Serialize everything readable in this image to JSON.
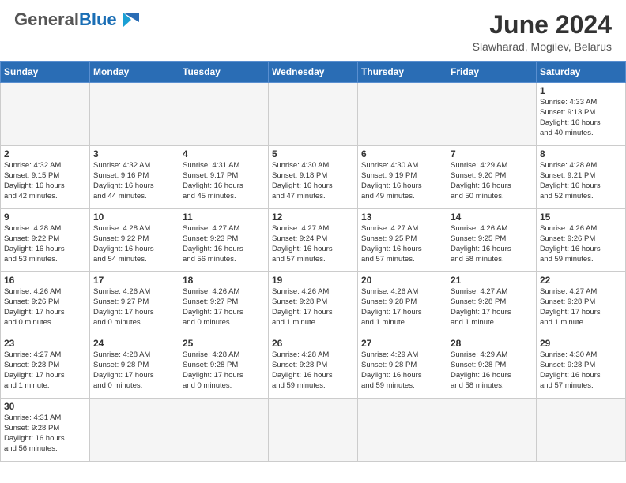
{
  "header": {
    "logo_general": "General",
    "logo_blue": "Blue",
    "month_title": "June 2024",
    "location": "Slawharad, Mogilev, Belarus"
  },
  "weekdays": [
    "Sunday",
    "Monday",
    "Tuesday",
    "Wednesday",
    "Thursday",
    "Friday",
    "Saturday"
  ],
  "weeks": [
    [
      {
        "day": "",
        "info": ""
      },
      {
        "day": "",
        "info": ""
      },
      {
        "day": "",
        "info": ""
      },
      {
        "day": "",
        "info": ""
      },
      {
        "day": "",
        "info": ""
      },
      {
        "day": "",
        "info": ""
      },
      {
        "day": "1",
        "info": "Sunrise: 4:33 AM\nSunset: 9:13 PM\nDaylight: 16 hours\nand 40 minutes."
      }
    ],
    [
      {
        "day": "2",
        "info": "Sunrise: 4:32 AM\nSunset: 9:15 PM\nDaylight: 16 hours\nand 42 minutes."
      },
      {
        "day": "3",
        "info": "Sunrise: 4:32 AM\nSunset: 9:16 PM\nDaylight: 16 hours\nand 44 minutes."
      },
      {
        "day": "4",
        "info": "Sunrise: 4:31 AM\nSunset: 9:17 PM\nDaylight: 16 hours\nand 45 minutes."
      },
      {
        "day": "5",
        "info": "Sunrise: 4:30 AM\nSunset: 9:18 PM\nDaylight: 16 hours\nand 47 minutes."
      },
      {
        "day": "6",
        "info": "Sunrise: 4:30 AM\nSunset: 9:19 PM\nDaylight: 16 hours\nand 49 minutes."
      },
      {
        "day": "7",
        "info": "Sunrise: 4:29 AM\nSunset: 9:20 PM\nDaylight: 16 hours\nand 50 minutes."
      },
      {
        "day": "8",
        "info": "Sunrise: 4:28 AM\nSunset: 9:21 PM\nDaylight: 16 hours\nand 52 minutes."
      }
    ],
    [
      {
        "day": "9",
        "info": "Sunrise: 4:28 AM\nSunset: 9:22 PM\nDaylight: 16 hours\nand 53 minutes."
      },
      {
        "day": "10",
        "info": "Sunrise: 4:28 AM\nSunset: 9:22 PM\nDaylight: 16 hours\nand 54 minutes."
      },
      {
        "day": "11",
        "info": "Sunrise: 4:27 AM\nSunset: 9:23 PM\nDaylight: 16 hours\nand 56 minutes."
      },
      {
        "day": "12",
        "info": "Sunrise: 4:27 AM\nSunset: 9:24 PM\nDaylight: 16 hours\nand 57 minutes."
      },
      {
        "day": "13",
        "info": "Sunrise: 4:27 AM\nSunset: 9:25 PM\nDaylight: 16 hours\nand 57 minutes."
      },
      {
        "day": "14",
        "info": "Sunrise: 4:26 AM\nSunset: 9:25 PM\nDaylight: 16 hours\nand 58 minutes."
      },
      {
        "day": "15",
        "info": "Sunrise: 4:26 AM\nSunset: 9:26 PM\nDaylight: 16 hours\nand 59 minutes."
      }
    ],
    [
      {
        "day": "16",
        "info": "Sunrise: 4:26 AM\nSunset: 9:26 PM\nDaylight: 17 hours\nand 0 minutes."
      },
      {
        "day": "17",
        "info": "Sunrise: 4:26 AM\nSunset: 9:27 PM\nDaylight: 17 hours\nand 0 minutes."
      },
      {
        "day": "18",
        "info": "Sunrise: 4:26 AM\nSunset: 9:27 PM\nDaylight: 17 hours\nand 0 minutes."
      },
      {
        "day": "19",
        "info": "Sunrise: 4:26 AM\nSunset: 9:28 PM\nDaylight: 17 hours\nand 1 minute."
      },
      {
        "day": "20",
        "info": "Sunrise: 4:26 AM\nSunset: 9:28 PM\nDaylight: 17 hours\nand 1 minute."
      },
      {
        "day": "21",
        "info": "Sunrise: 4:27 AM\nSunset: 9:28 PM\nDaylight: 17 hours\nand 1 minute."
      },
      {
        "day": "22",
        "info": "Sunrise: 4:27 AM\nSunset: 9:28 PM\nDaylight: 17 hours\nand 1 minute."
      }
    ],
    [
      {
        "day": "23",
        "info": "Sunrise: 4:27 AM\nSunset: 9:28 PM\nDaylight: 17 hours\nand 1 minute."
      },
      {
        "day": "24",
        "info": "Sunrise: 4:28 AM\nSunset: 9:28 PM\nDaylight: 17 hours\nand 0 minutes."
      },
      {
        "day": "25",
        "info": "Sunrise: 4:28 AM\nSunset: 9:28 PM\nDaylight: 17 hours\nand 0 minutes."
      },
      {
        "day": "26",
        "info": "Sunrise: 4:28 AM\nSunset: 9:28 PM\nDaylight: 16 hours\nand 59 minutes."
      },
      {
        "day": "27",
        "info": "Sunrise: 4:29 AM\nSunset: 9:28 PM\nDaylight: 16 hours\nand 59 minutes."
      },
      {
        "day": "28",
        "info": "Sunrise: 4:29 AM\nSunset: 9:28 PM\nDaylight: 16 hours\nand 58 minutes."
      },
      {
        "day": "29",
        "info": "Sunrise: 4:30 AM\nSunset: 9:28 PM\nDaylight: 16 hours\nand 57 minutes."
      }
    ],
    [
      {
        "day": "30",
        "info": "Sunrise: 4:31 AM\nSunset: 9:28 PM\nDaylight: 16 hours\nand 56 minutes."
      },
      {
        "day": "",
        "info": ""
      },
      {
        "day": "",
        "info": ""
      },
      {
        "day": "",
        "info": ""
      },
      {
        "day": "",
        "info": ""
      },
      {
        "day": "",
        "info": ""
      },
      {
        "day": "",
        "info": ""
      }
    ]
  ]
}
